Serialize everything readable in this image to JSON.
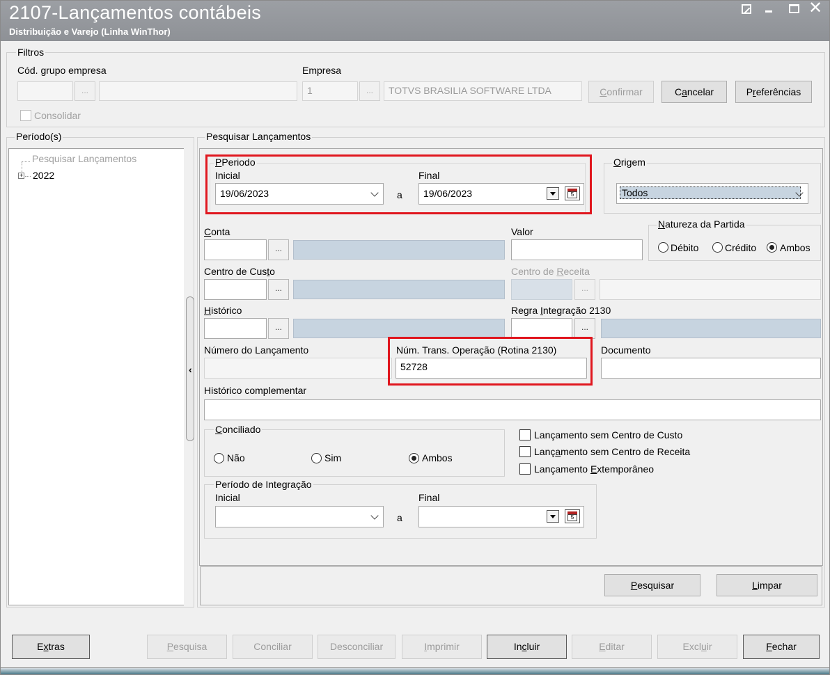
{
  "window": {
    "title": "2107-Lançamentos contábeis",
    "subtitle": "Distribuição e Varejo (Linha WinThor)"
  },
  "filtros": {
    "title": "Filtros",
    "cod_grupo_empresa_label": "Cód. grupo empresa",
    "empresa_label": "Empresa",
    "empresa_code": "1",
    "empresa_name": "TOTVS BRASILIA SOFTWARE LTDA",
    "consolidar_label": "Consolidar",
    "confirmar_label": "Confirmar",
    "cancelar_label": "Cancelar",
    "preferencias_label": "Preferências",
    "ellipsis": "..."
  },
  "periodos": {
    "title": "Período(s)",
    "tree_root": "Pesquisar Lançamentos",
    "tree_item": "2022"
  },
  "pesquisar": {
    "title": "Pesquisar Lançamentos",
    "periodo_title": "Periodo",
    "inicial_label": "Inicial",
    "final_label": "Final",
    "inicial_value": "19/06/2023",
    "final_value": "19/06/2023",
    "a_label": "a",
    "origem_title": "Origem",
    "origem_value": "Todos",
    "conta_label": "Conta",
    "valor_label": "Valor",
    "natureza_title": "Natureza da Partida",
    "debito_label": "Débito",
    "credito_label": "Crédito",
    "ambos_label": "Ambos",
    "centro_custo_label": "Centro de Custo",
    "centro_receita_label": "Centro de Receita",
    "historico_label": "Histórico",
    "regra_label": "Regra Integração 2130",
    "numero_lancamento_label": "Número do Lançamento",
    "num_trans_label": "Núm. Trans. Operação (Rotina 2130)",
    "num_trans_value": "52728",
    "documento_label": "Documento",
    "historico_comp_label": "Histórico complementar",
    "conciliado_title": "Conciliado",
    "nao_label": "Não",
    "sim_label": "Sim",
    "ambos2_label": "Ambos",
    "chk_sem_cc": "Lançamento sem Centro de Custo",
    "chk_sem_cr": "Lançamento sem Centro de Receita",
    "chk_extemp": "Lançamento Extemporâneo",
    "periodo_integracao_title": "Período de Integração",
    "pesquisar_btn": "Pesquisar",
    "limpar_btn": "Limpar"
  },
  "footer": {
    "extras": "Extras",
    "pesquisa": "Pesquisa",
    "conciliar": "Conciliar",
    "desconciliar": "Desconciliar",
    "imprimir": "Imprimir",
    "incluir": "Incluir",
    "editar": "Editar",
    "excluir": "Excluir",
    "fechar": "Fechar"
  },
  "colors": {
    "highlight_box": "#e0161e",
    "titlebar": "#9a9da2",
    "selection": "#c7d4e0"
  }
}
